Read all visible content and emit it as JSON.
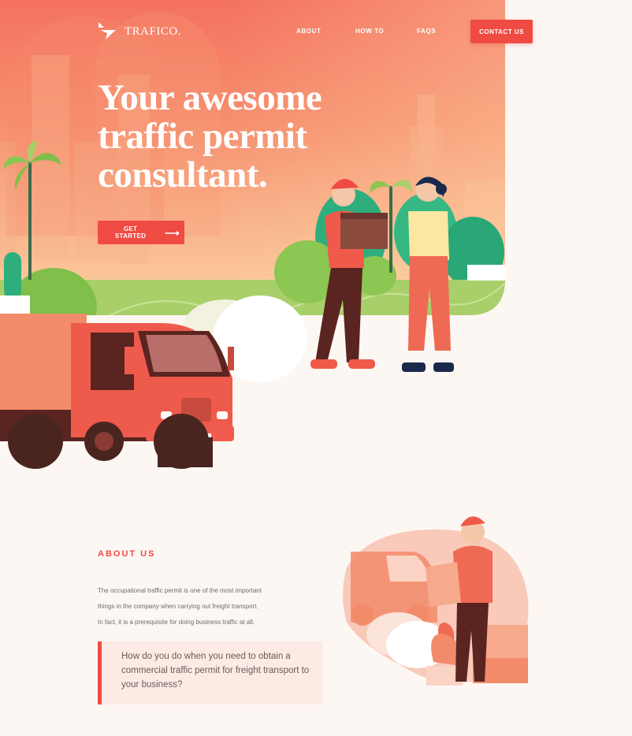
{
  "brand": {
    "name": "TRAFICO.",
    "logo_icon": "triangle-flag-logo-icon"
  },
  "nav": {
    "items": [
      {
        "label": "ABOUT"
      },
      {
        "label": "HOW TO"
      },
      {
        "label": "FAQS"
      }
    ],
    "contact_label": "CONTACT US"
  },
  "hero": {
    "headline": [
      "Your awesome",
      "traffic permit",
      "consultant."
    ],
    "cta_label": "GET STARTED",
    "cta_icon": "arrow-right-icon"
  },
  "about": {
    "heading": "ABOUT US",
    "paragraph": [
      "The occupational traffic permit is one of the most important",
      "things in the company when carrying out freight transport.",
      "In fact, it is a prerequisite for doing business traffic at all."
    ],
    "quote": "How do you do when you need to obtain a commercial traffic permit for freight transport to your business?"
  },
  "colors": {
    "accent": "#ef4b43",
    "hero_top": "#f4725f",
    "hero_bottom": "#fbd3a3",
    "page_bg": "#fdf7f3",
    "grass": "#a9cf6a"
  }
}
